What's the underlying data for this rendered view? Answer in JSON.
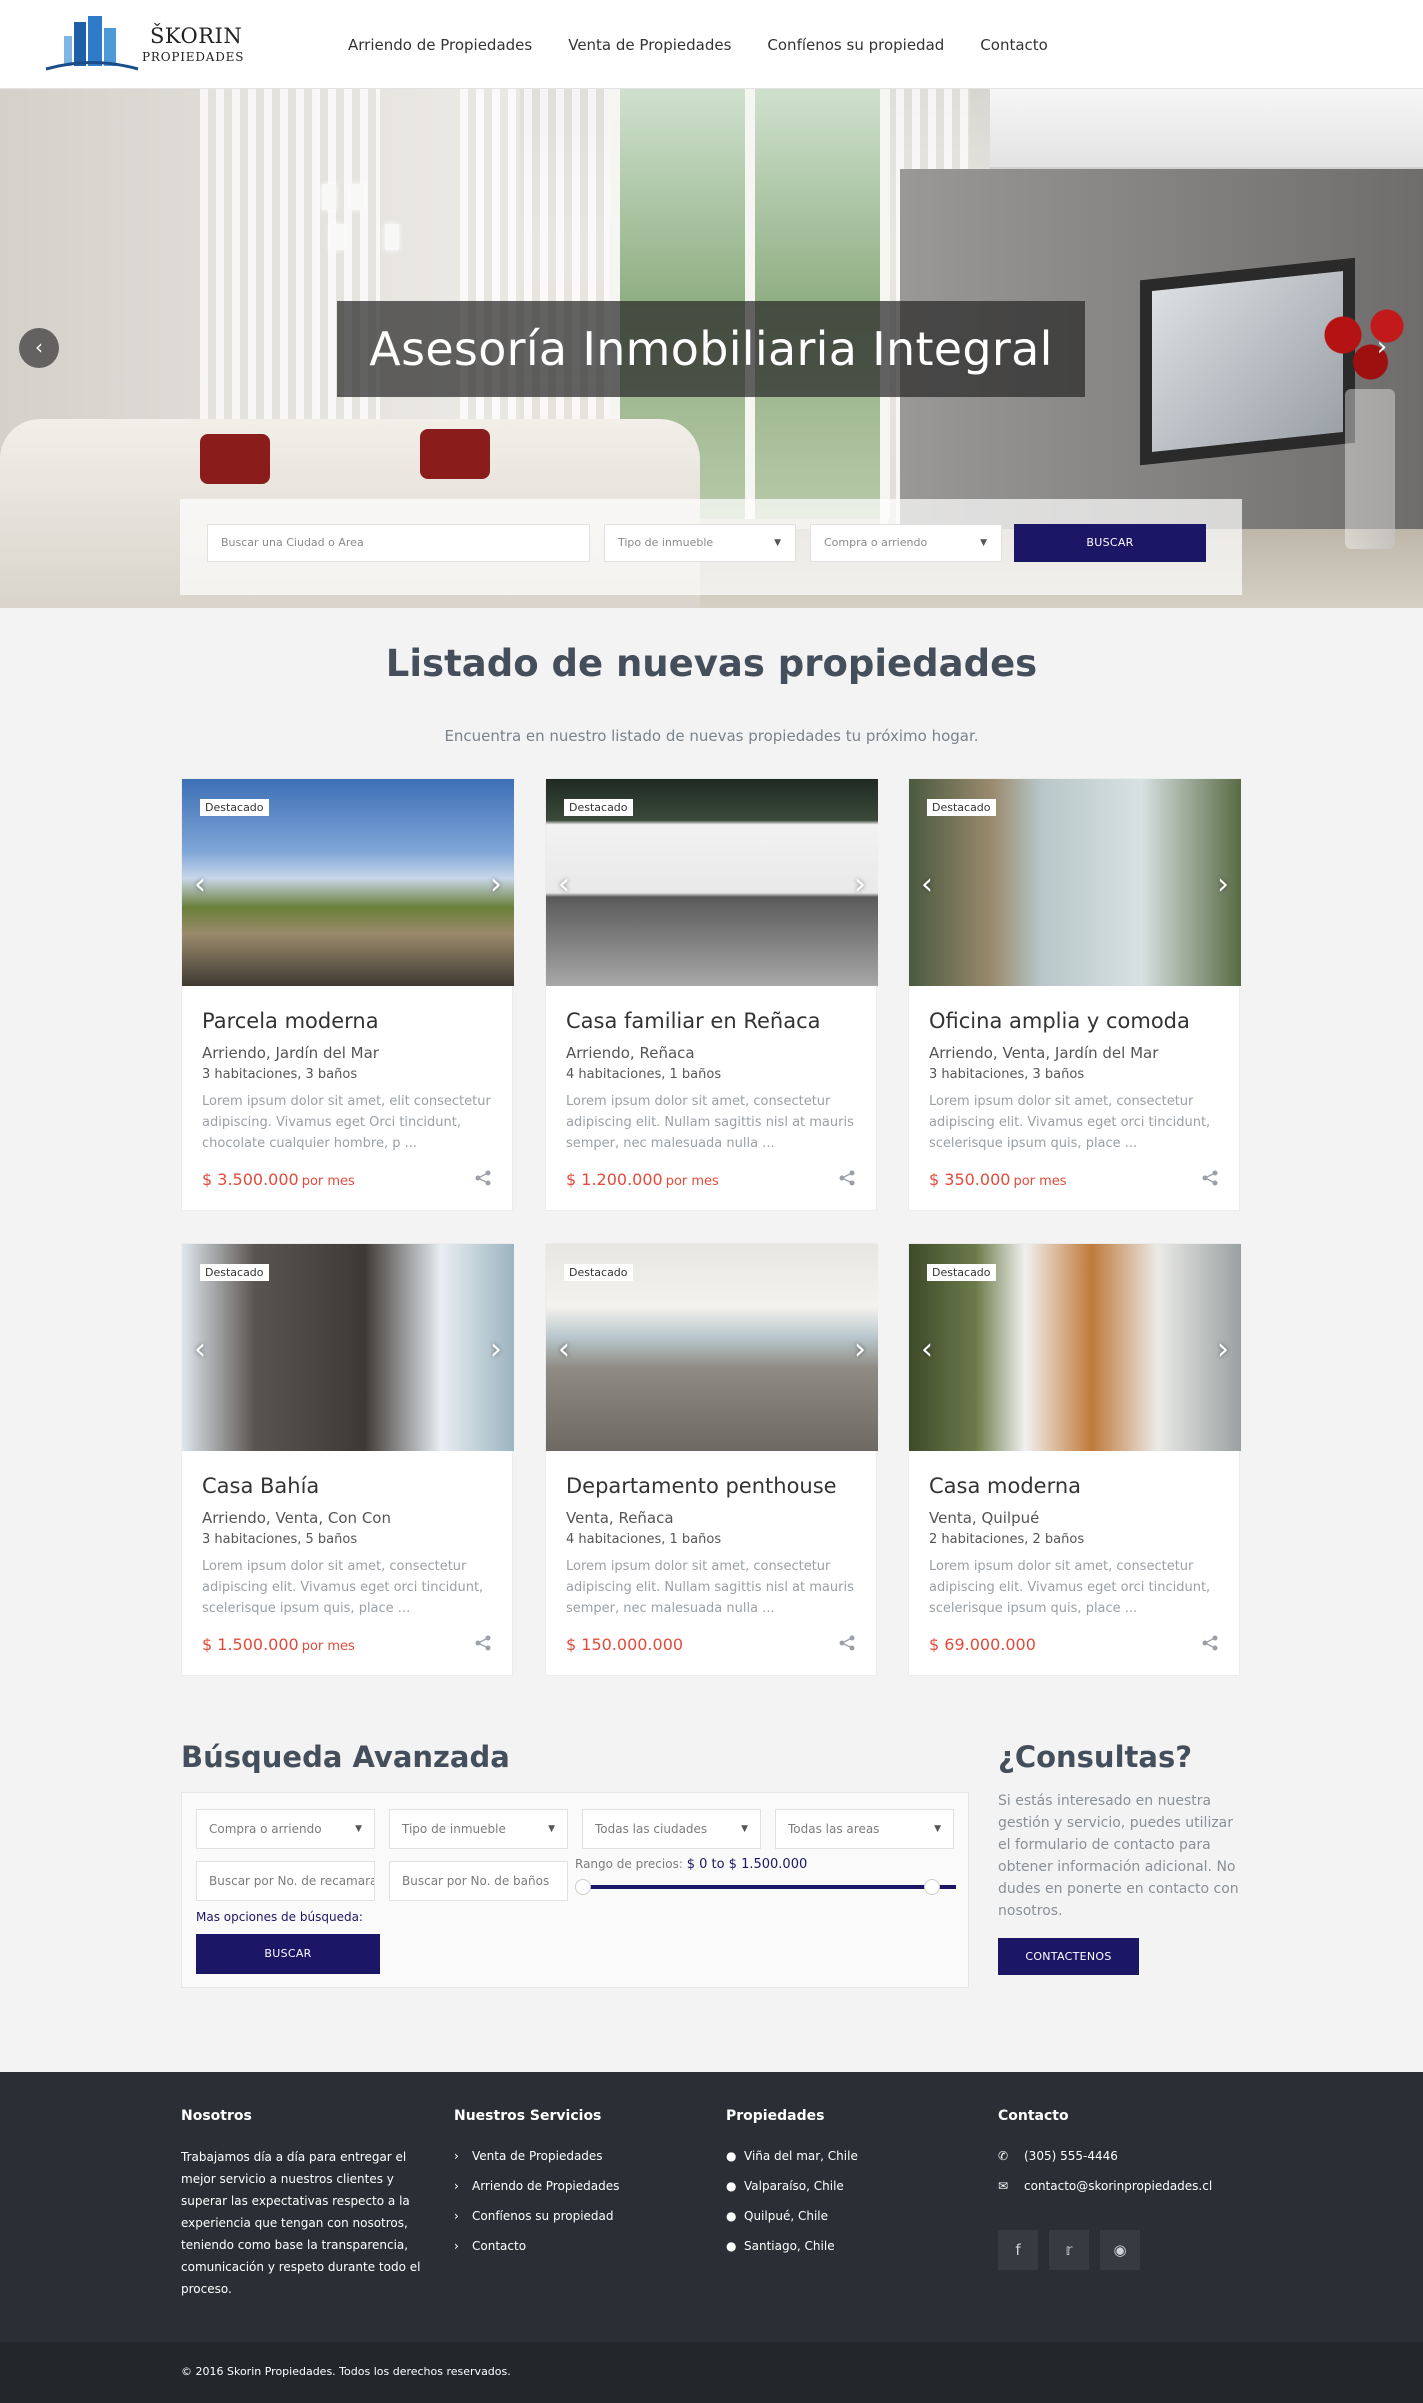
{
  "brand": {
    "name": "ŠKORIN",
    "sub": "PROPIEDADES"
  },
  "nav": [
    "Arriendo de Propiedades",
    "Venta de Propiedades",
    "Confíenos su propiedad",
    "Contacto"
  ],
  "hero": {
    "title": "Asesoría Inmobiliaria Integral",
    "prev_icon": "chevron-left-icon",
    "next_icon": "chevron-right-icon",
    "search_placeholder": "Buscar una Ciudad o Area",
    "type_select": "Tipo de inmueble",
    "mode_select": "Compra o arriendo",
    "button": "BUSCAR"
  },
  "listing": {
    "title": "Listado de nuevas propiedades",
    "subtitle": "Encuentra en nuestro listado de nuevas propiedades tu próximo hogar.",
    "badge": "Destacado",
    "cards": [
      {
        "title": "Parcela moderna",
        "location": "Arriendo, Jardín del Mar",
        "rooms": "3 habitaciones, 3 baños",
        "desc": "Lorem ipsum dolor sit amet, elit consectetur adipiscing. Vivamus eget Orci tincidunt, chocolate cualquier hombre, p ...",
        "price": "$ 3.500.000",
        "per": "por mes"
      },
      {
        "title": "Casa familiar en Reñaca",
        "location": "Arriendo, Reñaca",
        "rooms": "4 habitaciones, 1 baños",
        "desc": "Lorem ipsum dolor sit amet, consectetur adipiscing elit. Nullam sagittis nisl at mauris semper, nec malesuada nulla ...",
        "price": "$ 1.200.000",
        "per": "por mes"
      },
      {
        "title": "Oficina amplia y comoda",
        "location": "Arriendo, Venta, Jardín del Mar",
        "rooms": "3 habitaciones, 3 baños",
        "desc": "Lorem ipsum dolor sit amet, consectetur adipiscing elit. Vivamus eget orci tincidunt, scelerisque ipsum quis, place ...",
        "price": "$ 350.000",
        "per": "por mes"
      },
      {
        "title": "Casa Bahía",
        "location": "Arriendo, Venta, Con Con",
        "rooms": "3 habitaciones, 5 baños",
        "desc": "Lorem ipsum dolor sit amet, consectetur adipiscing elit. Vivamus eget orci tincidunt, scelerisque ipsum quis, place ...",
        "price": "$ 1.500.000",
        "per": "por mes"
      },
      {
        "title": "Departamento penthouse",
        "location": "Venta, Reñaca",
        "rooms": "4 habitaciones, 1 baños",
        "desc": "Lorem ipsum dolor sit amet, consectetur adipiscing elit. Nullam sagittis nisl at mauris semper, nec malesuada nulla ...",
        "price": "$ 150.000.000",
        "per": ""
      },
      {
        "title": "Casa moderna",
        "location": "Venta, Quilpué",
        "rooms": "2 habitaciones, 2 baños",
        "desc": "Lorem ipsum dolor sit amet, consectetur adipiscing elit. Vivamus eget orci tincidunt, scelerisque ipsum quis, place ...",
        "price": "$ 69.000.000",
        "per": ""
      }
    ]
  },
  "advanced": {
    "title": "Búsqueda Avanzada",
    "mode": "Compra o arriendo",
    "type": "Tipo de inmueble",
    "city": "Todas las ciudades",
    "area": "Todas las areas",
    "bedrooms_placeholder": "Buscar por No. de recamaras",
    "baths_placeholder": "Buscar por No. de baños",
    "range_label": "Rango de precios:",
    "range_value": "$ 0 to $ 1.500.000",
    "range_fraction": 1.0,
    "more": "Mas opciones de búsqueda:",
    "button": "BUSCAR"
  },
  "consultas": {
    "title": "¿Consultas?",
    "text": "Si estás interesado en nuestra gestión y servicio, puedes utilizar el formulario de contacto para obtener información adicional. No dudes en ponerte en contacto con nosotros.",
    "button": "CONTACTENOS"
  },
  "footer": {
    "nosotros_title": "Nosotros",
    "nosotros_text": "Trabajamos día a día para entregar el mejor servicio a nuestros clientes y superar las expectativas respecto a la experiencia que tengan con nosotros, teniendo como base la transparencia, comunicación y respeto durante todo el proceso.",
    "servicios_title": "Nuestros Servicios",
    "servicios": [
      "Venta de Propiedades",
      "Arriendo de Propiedades",
      "Confíenos su propiedad",
      "Contacto"
    ],
    "propiedades_title": "Propiedades",
    "propiedades": [
      "Viña del mar, Chile",
      "Valparaíso, Chile",
      "Quilpué, Chile",
      "Santiago, Chile"
    ],
    "contacto_title": "Contacto",
    "phone": "(305) 555-4446",
    "email": "contacto@skorinpropiedades.cl",
    "social": [
      "facebook-icon",
      "twitter-icon",
      "instagram-icon"
    ],
    "copyright": "© 2016 Skorin Propiedades. Todos los derechos reservados."
  },
  "colors": {
    "navy": "#1c1666",
    "price": "#e24b3b",
    "footer": "#2b2f35"
  }
}
